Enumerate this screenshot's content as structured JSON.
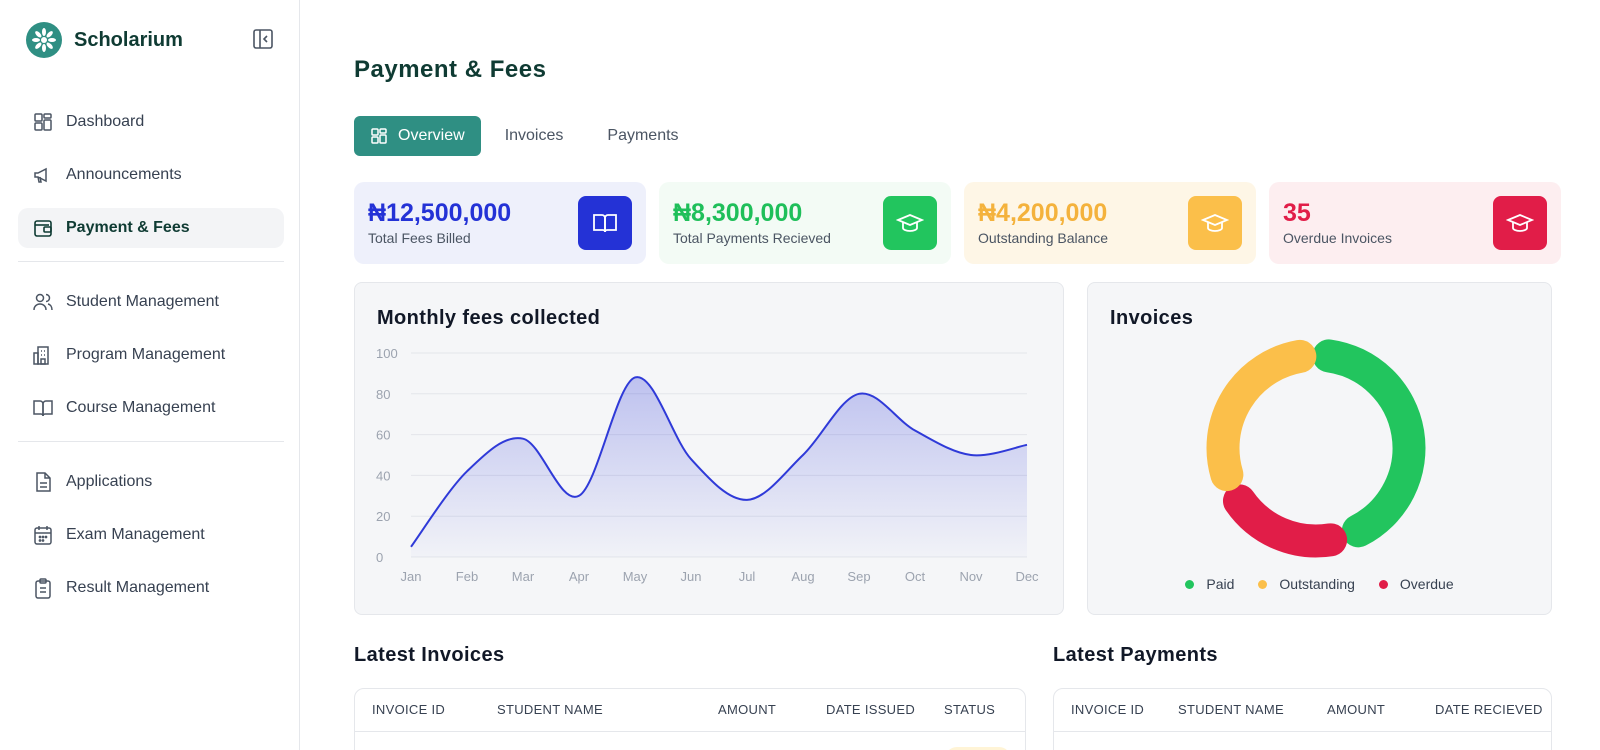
{
  "app": {
    "name": "Scholarium"
  },
  "sidebar": {
    "items": [
      {
        "label": "Dashboard",
        "icon": "dashboard-icon"
      },
      {
        "label": "Announcements",
        "icon": "megaphone-icon"
      },
      {
        "label": "Payment & Fees",
        "icon": "wallet-icon",
        "active": true
      },
      {
        "label": "Student Management",
        "icon": "users-icon"
      },
      {
        "label": "Program Management",
        "icon": "building-icon"
      },
      {
        "label": "Course Management",
        "icon": "book-icon"
      },
      {
        "label": "Applications",
        "icon": "document-icon"
      },
      {
        "label": "Exam Management",
        "icon": "calendar-icon"
      },
      {
        "label": "Result Management",
        "icon": "clipboard-icon"
      }
    ]
  },
  "page": {
    "title": "Payment & Fees"
  },
  "tabs": [
    {
      "label": "Overview",
      "active": true
    },
    {
      "label": "Invoices"
    },
    {
      "label": "Payments"
    }
  ],
  "stats": [
    {
      "value": "₦12,500,000",
      "label": "Total Fees Billed",
      "icon": "book-open-icon",
      "color": "#2432d6",
      "bg": "#eef0fb",
      "icon_bg": "#2432d6"
    },
    {
      "value": "₦8,300,000",
      "label": "Total Payments Recieved",
      "icon": "graduation-cap-icon",
      "color": "#1fbf5a",
      "bg": "#f3fbf5",
      "icon_bg": "#22c55e"
    },
    {
      "value": "₦4,200,000",
      "label": "Outstanding Balance",
      "icon": "graduation-cap-icon",
      "color": "#f4b23c",
      "bg": "#fef6e6",
      "icon_bg": "#fbbf4a"
    },
    {
      "value": "35",
      "label": "Overdue Invoices",
      "icon": "graduation-cap-icon",
      "color": "#e11d48",
      "bg": "#fdeef0",
      "icon_bg": "#e11d48"
    }
  ],
  "monthly_panel": {
    "title": "Monthly fees collected"
  },
  "invoices_panel": {
    "title": "Invoices",
    "legend": [
      {
        "label": "Paid",
        "color": "#22c55e"
      },
      {
        "label": "Outstanding",
        "color": "#fbbf4a"
      },
      {
        "label": "Overdue",
        "color": "#e11d48"
      }
    ]
  },
  "chart_data": [
    {
      "type": "area",
      "title": "Monthly fees collected",
      "categories": [
        "Jan",
        "Feb",
        "Mar",
        "Apr",
        "May",
        "Jun",
        "Jul",
        "Aug",
        "Sep",
        "Oct",
        "Nov",
        "Dec"
      ],
      "values": [
        5,
        42,
        58,
        30,
        88,
        48,
        28,
        50,
        80,
        62,
        50,
        55
      ],
      "ylim": [
        0,
        100
      ],
      "yticks": [
        0,
        20,
        40,
        60,
        80,
        100
      ],
      "grid": true,
      "color": "#2f3ad8"
    },
    {
      "type": "pie",
      "title": "Invoices",
      "labels": [
        "Paid",
        "Outstanding",
        "Overdue"
      ],
      "values": [
        45,
        30,
        20
      ],
      "colors": [
        "#22c55e",
        "#fbbf4a",
        "#e11d48"
      ],
      "legend": "bottom"
    }
  ],
  "latest_invoices": {
    "title": "Latest Invoices",
    "columns": [
      "INVOICE ID",
      "STUDENT NAME",
      "AMOUNT",
      "DATE ISSUED",
      "STATUS"
    ]
  },
  "latest_payments": {
    "title": "Latest Payments",
    "columns": [
      "INVOICE ID",
      "STUDENT NAME",
      "AMOUNT",
      "DATE RECIEVED"
    ]
  }
}
